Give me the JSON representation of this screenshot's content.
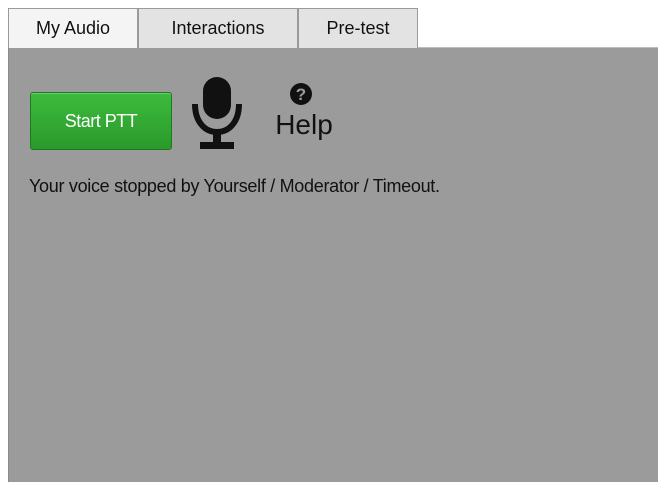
{
  "tabs": [
    {
      "label": "My Audio"
    },
    {
      "label": "Interactions"
    },
    {
      "label": "Pre-test"
    }
  ],
  "selected_tab": "My Audio",
  "audio_panel": {
    "ptt_button_label": "Start PTT",
    "ptt_button_color": "#2fa52f",
    "mic_icon": "microphone-icon",
    "help_icon": "question-circle-icon",
    "help_label": "Help",
    "status_text": "Your voice stopped by Yourself / Moderator / Timeout.",
    "panel_color": "#9b9b9b"
  }
}
